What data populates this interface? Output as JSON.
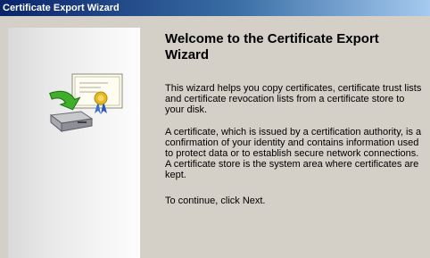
{
  "window": {
    "title": "Certificate Export Wizard"
  },
  "content": {
    "heading": "Welcome to the Certificate Export Wizard",
    "paragraph1": "This wizard helps you copy certificates, certificate trust lists and certificate revocation lists from a certificate store to your disk.",
    "paragraph2": "A certificate, which is issued by a certification authority, is a confirmation of your identity and contains information used to protect data or to establish secure network connections. A certificate store is the system area where certificates are kept.",
    "paragraph3": "To continue, click Next."
  },
  "icons": {
    "wizard": "certificate-export-icon"
  },
  "colors": {
    "titlebar_start": "#0a246a",
    "titlebar_end": "#a6caf0",
    "window_face": "#d4d0c8",
    "arrow_green": "#3fae2a",
    "ribbon_blue": "#3a6fd8",
    "seal_gold": "#e6b820"
  }
}
